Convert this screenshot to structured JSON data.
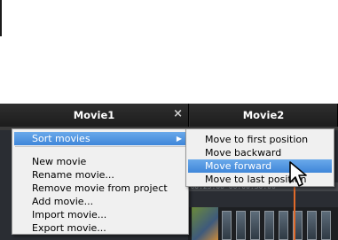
{
  "tabs": [
    {
      "label": "Movie1",
      "close_glyph": "×"
    },
    {
      "label": "Movie2"
    }
  ],
  "timeline": {
    "timecode_text": "00:00:25:00  00:00:30:00"
  },
  "context_menu": {
    "items": [
      {
        "label": "Sort movies",
        "has_submenu": true,
        "selected": true
      },
      {
        "label": "New movie"
      },
      {
        "label": "Rename movie..."
      },
      {
        "label": "Remove movie from project"
      },
      {
        "label": "Add movie..."
      },
      {
        "label": "Import movie..."
      },
      {
        "label": "Export movie..."
      }
    ],
    "submenu_arrow_glyph": "▶"
  },
  "submenu": {
    "items": [
      {
        "label": "Move to first position"
      },
      {
        "label": "Move backward"
      },
      {
        "label": "Move forward",
        "selected": true
      },
      {
        "label": "Move to last position"
      }
    ]
  },
  "icons": {
    "cursor": "arrow-pointer-icon",
    "close": "close-icon",
    "submenu": "chevron-right-icon"
  },
  "colors": {
    "menu_background": "#f0f0f0",
    "selection_blue": "#3f86d9",
    "tab_dark": "#1c1c1c",
    "playhead_orange": "#e06a2a"
  }
}
